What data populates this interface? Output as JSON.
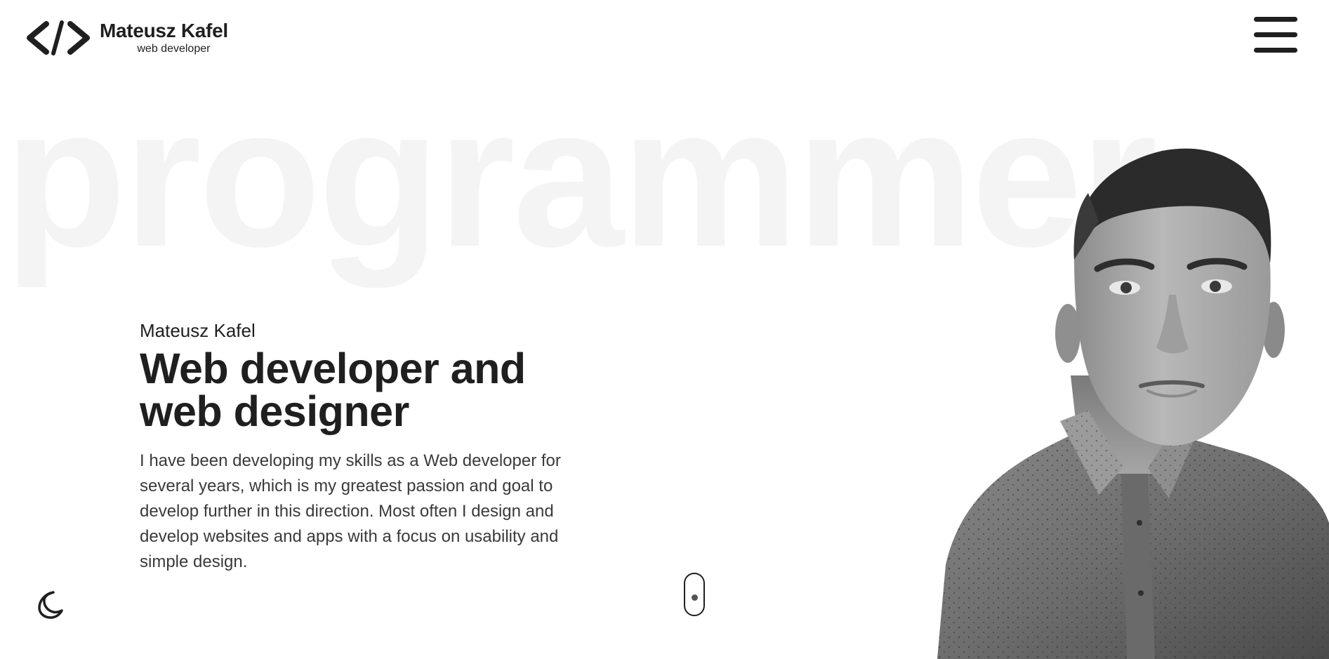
{
  "header": {
    "logo_name": "Mateusz Kafel",
    "logo_role": "web developer",
    "logo_icon": "code-brackets-icon",
    "menu_icon": "hamburger-menu-icon"
  },
  "background_word": "programmer",
  "hero": {
    "name": "Mateusz Kafel",
    "title_line1": "Web developer and",
    "title_line2": "web designer",
    "description": "I have been developing my skills as a Web developer for several years, which is my greatest passion and goal to develop further in this direction. Most often I design and develop websites and apps with a focus on usability and simple design."
  },
  "controls": {
    "theme_icon": "moon-icon",
    "scroll_icon": "mouse-scroll-icon"
  },
  "colors": {
    "text": "#1f1f1f",
    "background": "#ffffff",
    "bg_word": "#f4f4f4",
    "description": "#3a3a3a"
  }
}
